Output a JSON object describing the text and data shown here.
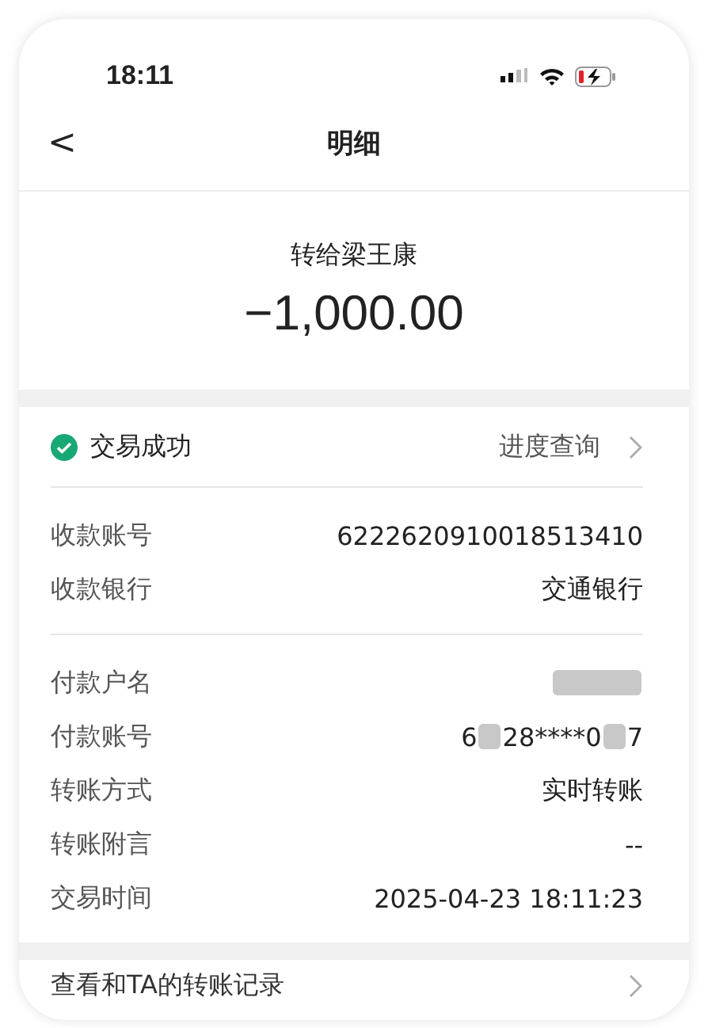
{
  "status_bar": {
    "time": "18:11"
  },
  "nav": {
    "back": "<",
    "title": "明细"
  },
  "summary": {
    "recipient": "转给梁王康",
    "amount": "−1,000.00"
  },
  "status": {
    "label": "交易成功",
    "success": true,
    "link": "进度查询"
  },
  "payee_rows": [
    {
      "label": "收款账号",
      "segments": [
        {
          "kind": "text",
          "text": "6222620910018513410"
        }
      ]
    },
    {
      "label": "收款银行",
      "segments": [
        {
          "kind": "text",
          "text": "交通银行"
        }
      ]
    }
  ],
  "payer_rows": [
    {
      "label": "付款户名",
      "segments": [
        {
          "kind": "blur"
        }
      ]
    },
    {
      "label": "付款账号",
      "segments": [
        {
          "kind": "text",
          "text": "6"
        },
        {
          "kind": "blur"
        },
        {
          "kind": "text",
          "text": "28****0"
        },
        {
          "kind": "blur"
        },
        {
          "kind": "text",
          "text": "7"
        }
      ]
    },
    {
      "label": "转账方式",
      "segments": [
        {
          "kind": "text",
          "text": "实时转账"
        }
      ]
    },
    {
      "label": "转账附言",
      "segments": [
        {
          "kind": "text",
          "text": "--"
        }
      ]
    },
    {
      "label": "交易时间",
      "segments": [
        {
          "kind": "text",
          "text": "2025-04-23 18:11:23"
        }
      ]
    }
  ],
  "history_link": {
    "label": "查看和TA的转账记录"
  }
}
